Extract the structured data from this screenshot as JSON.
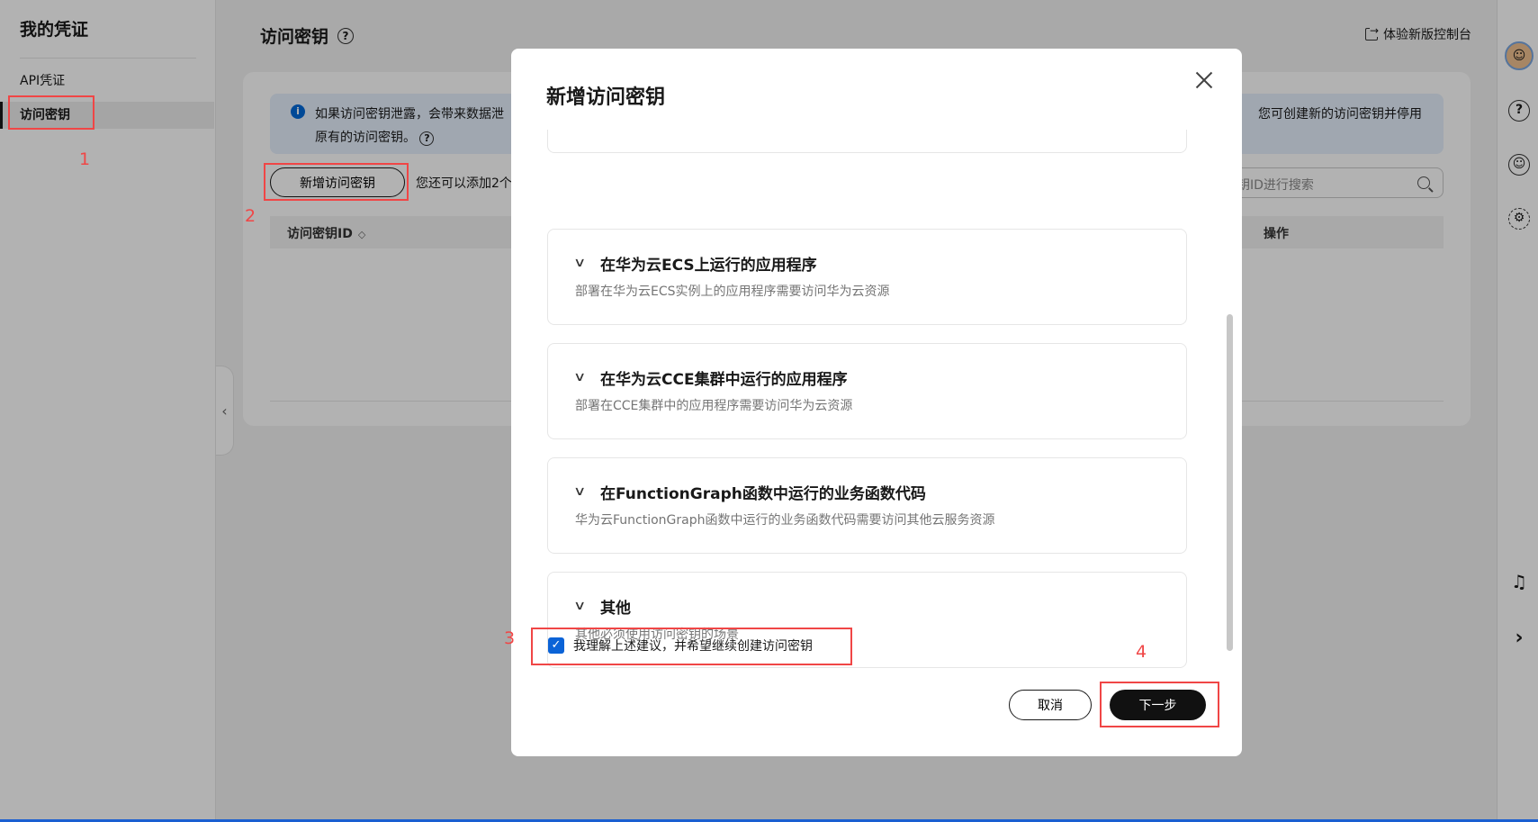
{
  "sidebar": {
    "title": "我的凭证",
    "items": [
      {
        "label": "API凭证",
        "active": false
      },
      {
        "label": "访问密钥",
        "active": true
      }
    ]
  },
  "header": {
    "title": "访问密钥",
    "help_icon": "question-circle-icon",
    "new_console_label": "体验新版控制台"
  },
  "main": {
    "info_left": "如果访问密钥泄露，会带来数据泄",
    "info_left_line2": "原有的访问密钥。",
    "info_right": "您可创建新的访问密钥并停用",
    "add_button_label": "新增访问密钥",
    "add_hint": "您还可以添加2个",
    "search_placeholder": "钥ID进行搜索",
    "table_columns": [
      "访问密钥ID",
      "操作"
    ]
  },
  "modal": {
    "title": "新增访问密钥",
    "sections": [
      {
        "title": "在华为云ECS上运行的应用程序",
        "desc": "部署在华为云ECS实例上的应用程序需要访问华为云资源"
      },
      {
        "title": "在华为云CCE集群中运行的应用程序",
        "desc": "部署在CCE集群中的应用程序需要访问华为云资源"
      },
      {
        "title": "在FunctionGraph函数中运行的业务函数代码",
        "desc": "华为云FunctionGraph函数中运行的业务函数代码需要访问其他云服务资源"
      },
      {
        "title": "其他",
        "desc": "其他必须使用访问密钥的场景"
      }
    ],
    "agree_label": "我理解上述建议，并希望继续创建访问密钥",
    "agree_checked": true,
    "cancel_label": "取消",
    "next_label": "下一步"
  },
  "annotations": [
    "1",
    "2",
    "3",
    "4"
  ],
  "colors": {
    "accent": "#0b63d7",
    "annotation": "#f04646",
    "primary_button": "#111111",
    "info_bg": "#e5effd"
  }
}
